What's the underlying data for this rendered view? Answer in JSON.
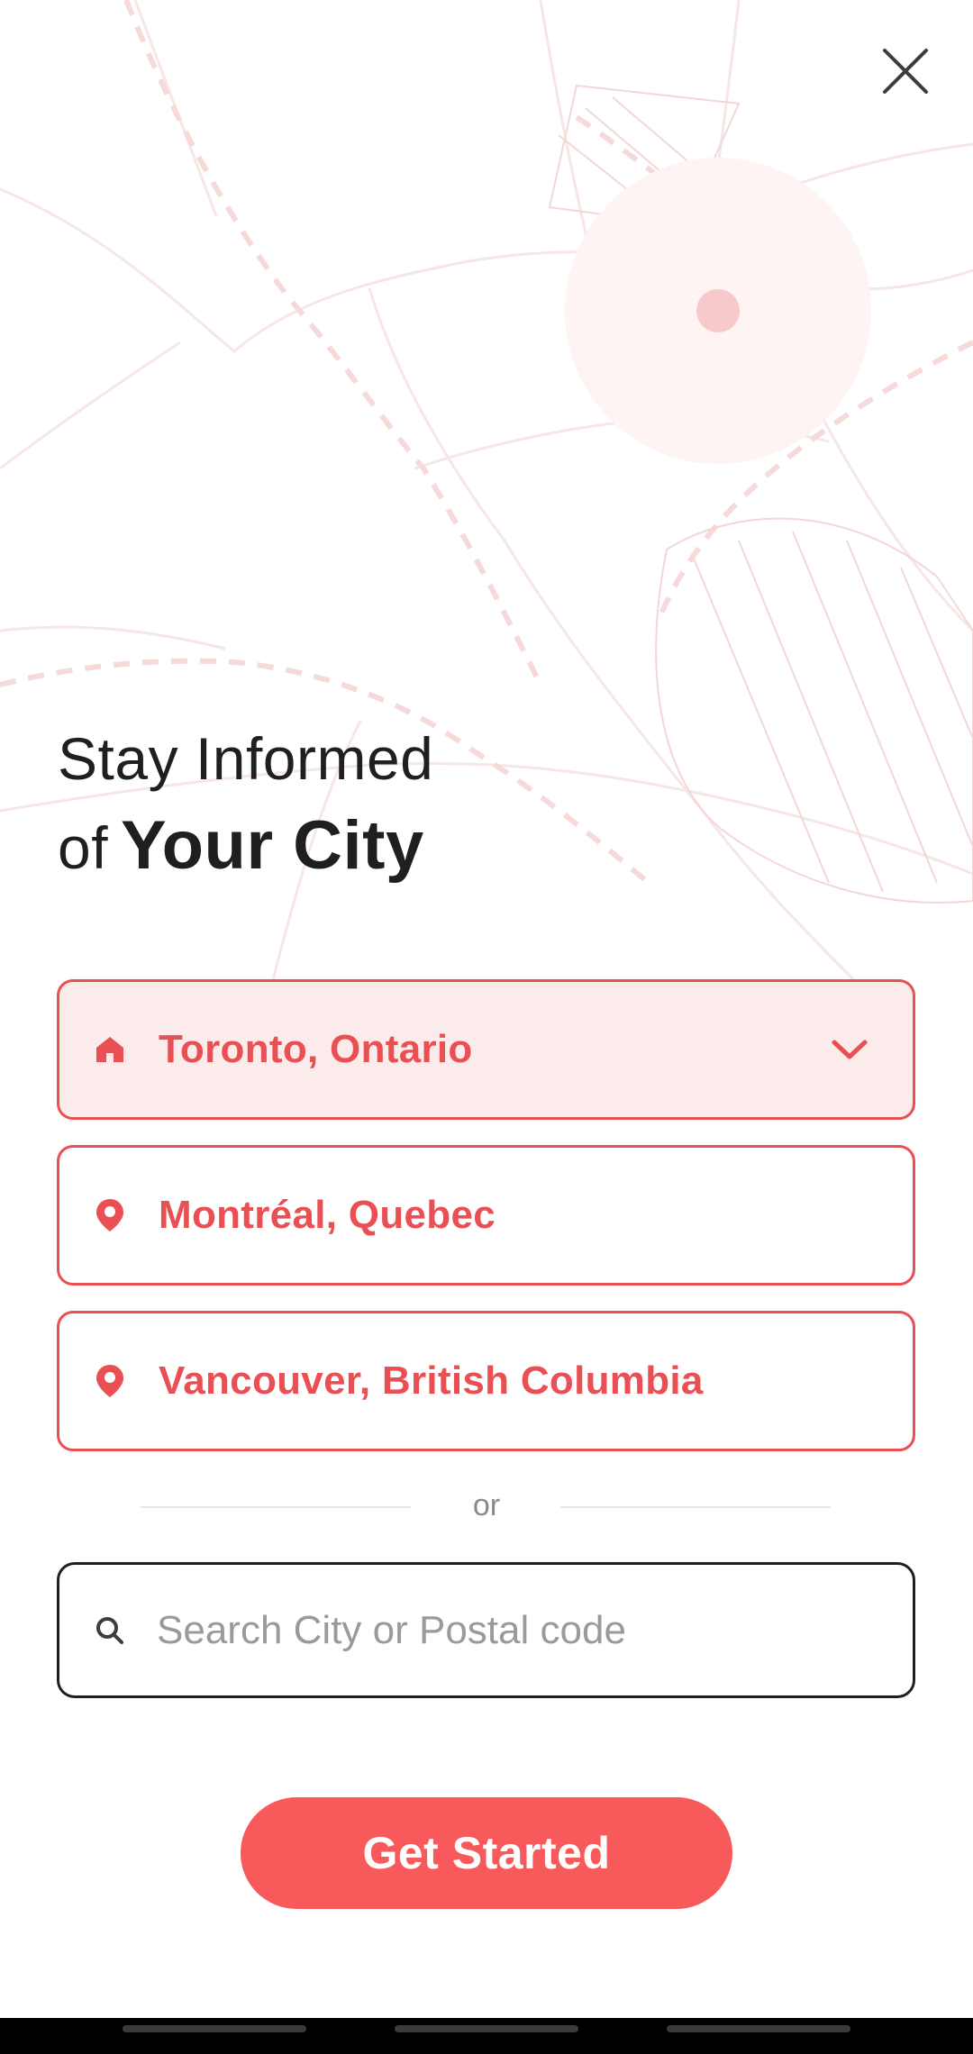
{
  "header": {
    "close_icon": "close-icon"
  },
  "headline": {
    "line1": "Stay Informed",
    "line2_prefix": "of",
    "line2_emphasis": "Your City"
  },
  "city_options": [
    {
      "label": "Toronto, Ontario",
      "icon": "home-icon",
      "selected": true
    },
    {
      "label": "Montréal, Quebec",
      "icon": "location-pin-icon",
      "selected": false
    },
    {
      "label": "Vancouver, British Columbia",
      "icon": "location-pin-icon",
      "selected": false
    }
  ],
  "divider": {
    "text": "or"
  },
  "search": {
    "placeholder": "Search City or Postal code",
    "value": "",
    "icon": "search-icon"
  },
  "cta": {
    "label": "Get Started"
  },
  "colors": {
    "accent": "#e94f53",
    "button": "#f85a5c",
    "selected_bg": "#fcebeb",
    "text_dark": "#1f1f1f",
    "placeholder": "#9a9a9a"
  }
}
